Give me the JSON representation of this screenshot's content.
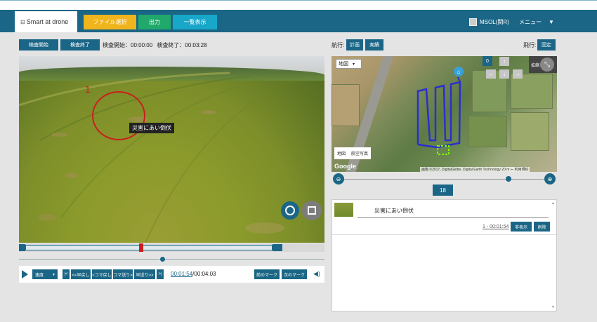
{
  "header": {
    "app_title": "Smart at drone",
    "nav": [
      "ファイル選択",
      "出力",
      "一覧表示"
    ],
    "nav_colors": [
      "#f0b41c",
      "#21a96b",
      "#18a7c9"
    ],
    "user_name": "MSOL(関R)",
    "menu_label": "メニュー"
  },
  "left": {
    "start_button": "検査開始",
    "end_button": "検査終了",
    "inspection_start_label": "検査開始：",
    "inspection_start_time": "00:00:00",
    "inspection_end_label": "検査終了：",
    "inspection_end_time": "00:03:28",
    "video": {
      "marker_number": "1",
      "marker_label": "災害にあい倒伏"
    },
    "controls": {
      "speed_label": "速度",
      "skip_start": "|<",
      "fast_rewind": "<<早戻し",
      "frame_back": "<コマ戻し",
      "frame_forward": "コマ送り>",
      "fast_forward": "早送り>>",
      "skip_end": ">|",
      "current_time": "00:01:54",
      "total_time": "/00:04:03",
      "prev_mark": "前のマーク",
      "next_mark": "次のマーク"
    },
    "timeline_marker_fraction": 0.47,
    "playback_fraction": 0.47
  },
  "right": {
    "route_label": "航行:",
    "plan_button": "計画",
    "actual_button": "実績",
    "flight_label": "飛行:",
    "fix_button": "固定",
    "map": {
      "map_type": "地図",
      "legend_map": "地図",
      "legend_satellite": "航空写真",
      "google": "Google",
      "copyright": "画像 ©2017, DigitalGlobe, Digital Earth Technology 20 m ⊢ 利用規約",
      "zero_button": "0",
      "fullscreen_label": "拡縮"
    },
    "zoom_level": "18",
    "zoom_fraction": 0.82,
    "list": [
      {
        "title": "災害にあい倒伏",
        "time": "1 - 00:01:54",
        "hide_button": "非表示",
        "delete_button": "削除"
      }
    ]
  },
  "colors": {
    "primary": "#1b6686",
    "marker": "#c81f1f",
    "route": "#2a2fcf"
  }
}
